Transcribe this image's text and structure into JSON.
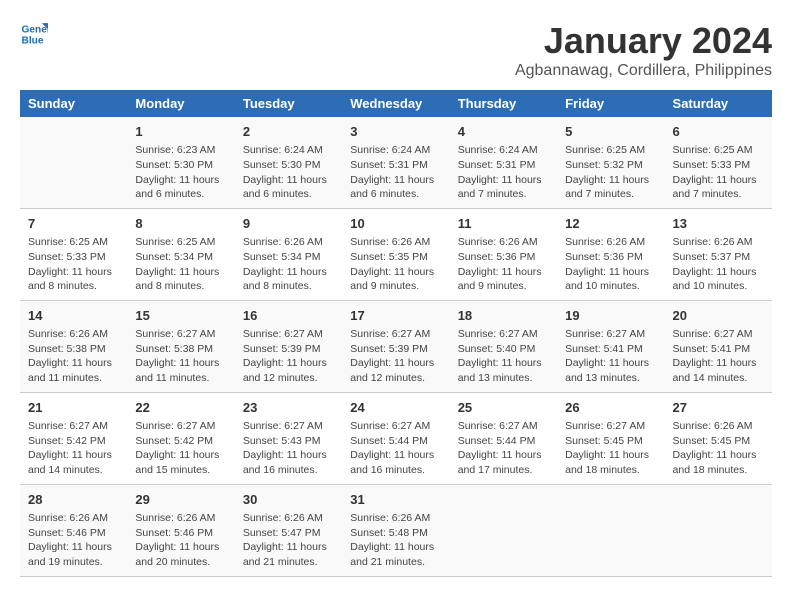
{
  "header": {
    "logo_line1": "General",
    "logo_line2": "Blue",
    "title": "January 2024",
    "subtitle": "Agbannawag, Cordillera, Philippines"
  },
  "days_of_week": [
    "Sunday",
    "Monday",
    "Tuesday",
    "Wednesday",
    "Thursday",
    "Friday",
    "Saturday"
  ],
  "weeks": [
    [
      {
        "day": "",
        "content": ""
      },
      {
        "day": "1",
        "content": "Sunrise: 6:23 AM\nSunset: 5:30 PM\nDaylight: 11 hours and 6 minutes."
      },
      {
        "day": "2",
        "content": "Sunrise: 6:24 AM\nSunset: 5:30 PM\nDaylight: 11 hours and 6 minutes."
      },
      {
        "day": "3",
        "content": "Sunrise: 6:24 AM\nSunset: 5:31 PM\nDaylight: 11 hours and 6 minutes."
      },
      {
        "day": "4",
        "content": "Sunrise: 6:24 AM\nSunset: 5:31 PM\nDaylight: 11 hours and 7 minutes."
      },
      {
        "day": "5",
        "content": "Sunrise: 6:25 AM\nSunset: 5:32 PM\nDaylight: 11 hours and 7 minutes."
      },
      {
        "day": "6",
        "content": "Sunrise: 6:25 AM\nSunset: 5:33 PM\nDaylight: 11 hours and 7 minutes."
      }
    ],
    [
      {
        "day": "7",
        "content": "Sunrise: 6:25 AM\nSunset: 5:33 PM\nDaylight: 11 hours and 8 minutes."
      },
      {
        "day": "8",
        "content": "Sunrise: 6:25 AM\nSunset: 5:34 PM\nDaylight: 11 hours and 8 minutes."
      },
      {
        "day": "9",
        "content": "Sunrise: 6:26 AM\nSunset: 5:34 PM\nDaylight: 11 hours and 8 minutes."
      },
      {
        "day": "10",
        "content": "Sunrise: 6:26 AM\nSunset: 5:35 PM\nDaylight: 11 hours and 9 minutes."
      },
      {
        "day": "11",
        "content": "Sunrise: 6:26 AM\nSunset: 5:36 PM\nDaylight: 11 hours and 9 minutes."
      },
      {
        "day": "12",
        "content": "Sunrise: 6:26 AM\nSunset: 5:36 PM\nDaylight: 11 hours and 10 minutes."
      },
      {
        "day": "13",
        "content": "Sunrise: 6:26 AM\nSunset: 5:37 PM\nDaylight: 11 hours and 10 minutes."
      }
    ],
    [
      {
        "day": "14",
        "content": "Sunrise: 6:26 AM\nSunset: 5:38 PM\nDaylight: 11 hours and 11 minutes."
      },
      {
        "day": "15",
        "content": "Sunrise: 6:27 AM\nSunset: 5:38 PM\nDaylight: 11 hours and 11 minutes."
      },
      {
        "day": "16",
        "content": "Sunrise: 6:27 AM\nSunset: 5:39 PM\nDaylight: 11 hours and 12 minutes."
      },
      {
        "day": "17",
        "content": "Sunrise: 6:27 AM\nSunset: 5:39 PM\nDaylight: 11 hours and 12 minutes."
      },
      {
        "day": "18",
        "content": "Sunrise: 6:27 AM\nSunset: 5:40 PM\nDaylight: 11 hours and 13 minutes."
      },
      {
        "day": "19",
        "content": "Sunrise: 6:27 AM\nSunset: 5:41 PM\nDaylight: 11 hours and 13 minutes."
      },
      {
        "day": "20",
        "content": "Sunrise: 6:27 AM\nSunset: 5:41 PM\nDaylight: 11 hours and 14 minutes."
      }
    ],
    [
      {
        "day": "21",
        "content": "Sunrise: 6:27 AM\nSunset: 5:42 PM\nDaylight: 11 hours and 14 minutes."
      },
      {
        "day": "22",
        "content": "Sunrise: 6:27 AM\nSunset: 5:42 PM\nDaylight: 11 hours and 15 minutes."
      },
      {
        "day": "23",
        "content": "Sunrise: 6:27 AM\nSunset: 5:43 PM\nDaylight: 11 hours and 16 minutes."
      },
      {
        "day": "24",
        "content": "Sunrise: 6:27 AM\nSunset: 5:44 PM\nDaylight: 11 hours and 16 minutes."
      },
      {
        "day": "25",
        "content": "Sunrise: 6:27 AM\nSunset: 5:44 PM\nDaylight: 11 hours and 17 minutes."
      },
      {
        "day": "26",
        "content": "Sunrise: 6:27 AM\nSunset: 5:45 PM\nDaylight: 11 hours and 18 minutes."
      },
      {
        "day": "27",
        "content": "Sunrise: 6:26 AM\nSunset: 5:45 PM\nDaylight: 11 hours and 18 minutes."
      }
    ],
    [
      {
        "day": "28",
        "content": "Sunrise: 6:26 AM\nSunset: 5:46 PM\nDaylight: 11 hours and 19 minutes."
      },
      {
        "day": "29",
        "content": "Sunrise: 6:26 AM\nSunset: 5:46 PM\nDaylight: 11 hours and 20 minutes."
      },
      {
        "day": "30",
        "content": "Sunrise: 6:26 AM\nSunset: 5:47 PM\nDaylight: 11 hours and 21 minutes."
      },
      {
        "day": "31",
        "content": "Sunrise: 6:26 AM\nSunset: 5:48 PM\nDaylight: 11 hours and 21 minutes."
      },
      {
        "day": "",
        "content": ""
      },
      {
        "day": "",
        "content": ""
      },
      {
        "day": "",
        "content": ""
      }
    ]
  ]
}
